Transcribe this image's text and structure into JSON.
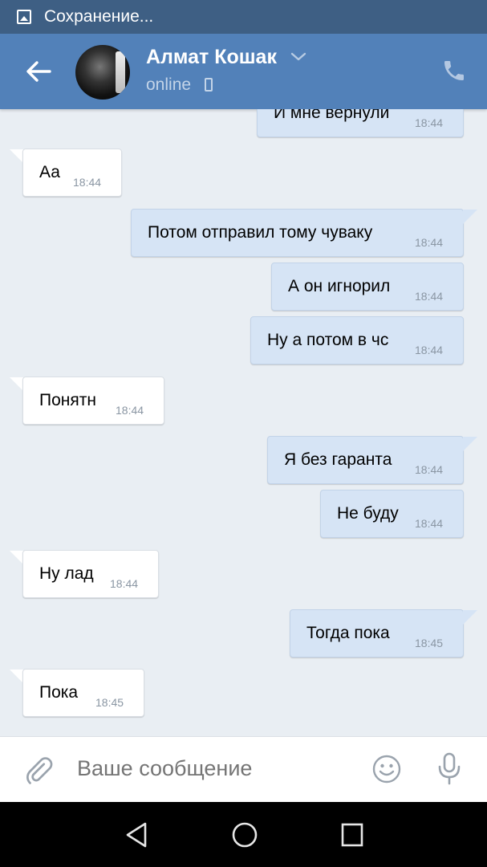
{
  "status_bar": {
    "text": "Сохранение...",
    "icon": "image-icon"
  },
  "header": {
    "contact_name": "Алмат Кошак",
    "presence": "online",
    "icons": [
      "back-arrow-icon",
      "chevron-down-icon",
      "mobile-phone-icon",
      "phone-call-icon"
    ]
  },
  "messages": [
    {
      "direction": "out",
      "text": "И мне вернули",
      "time": "18:44"
    },
    {
      "direction": "in",
      "text": "Аа",
      "time": "18:44"
    },
    {
      "direction": "out",
      "text": "Потом отправил тому чуваку",
      "time": "18:44"
    },
    {
      "direction": "out",
      "text": "А он игнорил",
      "time": "18:44"
    },
    {
      "direction": "out",
      "text": "Ну а потом в чс",
      "time": "18:44"
    },
    {
      "direction": "in",
      "text": "Понятн",
      "time": "18:44"
    },
    {
      "direction": "out",
      "text": "Я без гаранта",
      "time": "18:44"
    },
    {
      "direction": "out",
      "text": "Не буду",
      "time": "18:44"
    },
    {
      "direction": "in",
      "text": "Ну лад",
      "time": "18:44"
    },
    {
      "direction": "out",
      "text": "Тогда пока",
      "time": "18:45"
    },
    {
      "direction": "in",
      "text": "Пока",
      "time": "18:45"
    }
  ],
  "composer": {
    "placeholder": "Ваше сообщение"
  },
  "colors": {
    "header": "#5281b9",
    "status_bar": "#3e5f84",
    "outgoing_bubble": "#d6e4f5",
    "incoming_bubble": "#ffffff",
    "background": "#e9eef3"
  }
}
